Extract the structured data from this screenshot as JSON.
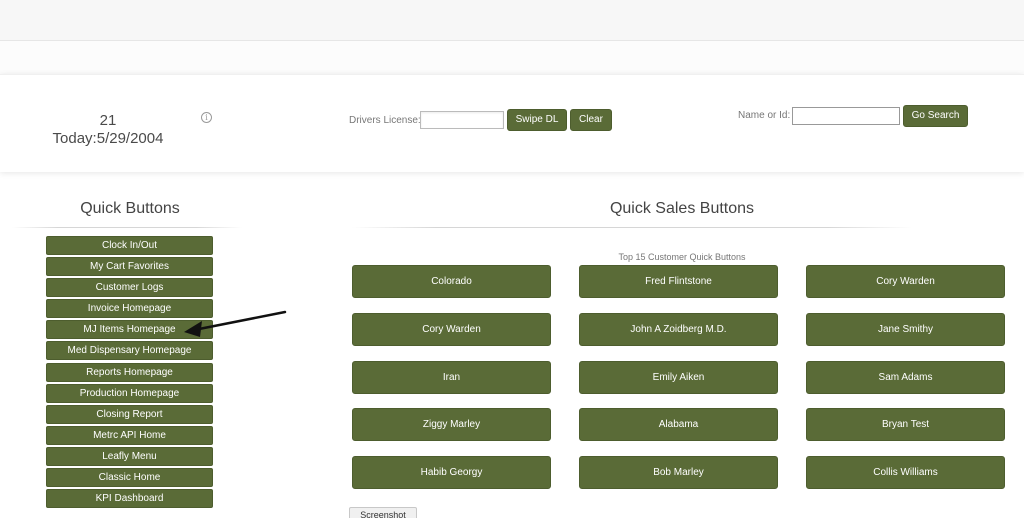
{
  "header": {
    "counter": "21",
    "today": "Today:5/29/2004",
    "info_icon": "info-icon",
    "drivers_license_label": "Drivers License:",
    "drivers_license_value": "",
    "swipe_dl_label": "Swipe DL",
    "clear_label": "Clear",
    "name_or_id_label": "Name or Id:",
    "name_or_id_value": "",
    "go_search_label": "Go Search"
  },
  "quick_buttons": {
    "title": "Quick Buttons",
    "items": [
      "Clock In/Out",
      "My Cart Favorites",
      "Customer Logs",
      "Invoice Homepage",
      "MJ Items Homepage",
      "Med Dispensary Homepage",
      "Reports Homepage",
      "Production Homepage",
      "Closing Report",
      "Metrc API Home",
      "Leafly Menu",
      "Classic Home",
      "KPI Dashboard"
    ]
  },
  "quick_sales": {
    "title": "Quick Sales Buttons",
    "subtitle": "Top 15 Customer Quick Buttons",
    "items": [
      "Colorado",
      "Fred Flintstone",
      "Cory Warden",
      "Cory Warden",
      "John A Zoidberg M.D.",
      "Jane Smithy",
      "Iran",
      "Emily Aiken",
      "Sam Adams",
      "Ziggy Marley",
      "Alabama",
      "Bryan Test",
      "Habib Georgy",
      "Bob Marley",
      "Collis Williams"
    ]
  },
  "screenshot_label": "Screenshot",
  "colors": {
    "button_green": "#5a6b37",
    "button_text": "#ffffff"
  }
}
